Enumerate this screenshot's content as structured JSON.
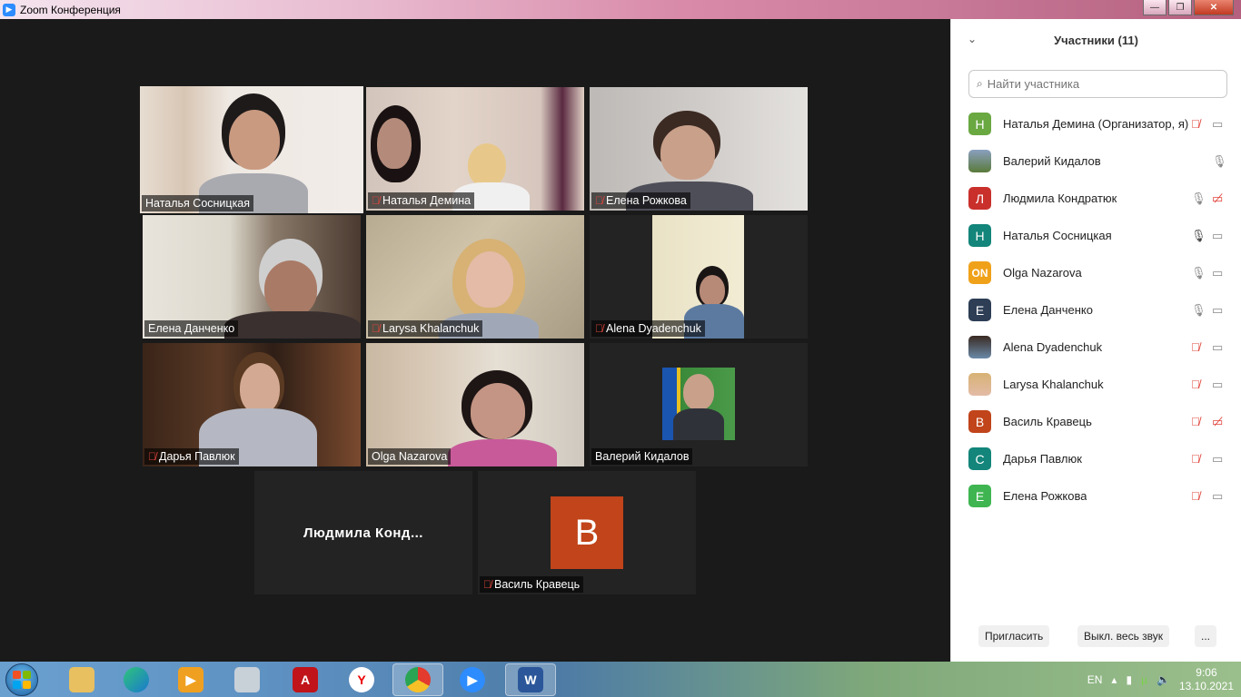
{
  "window": {
    "title": "Zoom Конференция",
    "minimize": "—",
    "maximize": "❐",
    "close": "✕"
  },
  "tiles": [
    {
      "name": "Наталья Сосницкая",
      "muted": false,
      "active": true
    },
    {
      "name": "Наталья Демина",
      "muted": true
    },
    {
      "name": "Елена Рожкова",
      "muted": true
    },
    {
      "name": "Елена Данченко",
      "muted": false
    },
    {
      "name": "Larysa Khalanchuk",
      "muted": true
    },
    {
      "name": "Alena Dyadenchuk",
      "muted": true
    },
    {
      "name": "Дарья Павлюк",
      "muted": true
    },
    {
      "name": "Olga Nazarova",
      "muted": false
    },
    {
      "name": "Валерий Кидалов",
      "muted": false
    },
    {
      "name": "Людмила  Конд...",
      "video": false
    },
    {
      "name": "Василь Кравець",
      "muted": true,
      "avatar_letter": "В"
    }
  ],
  "sidebar": {
    "title": "Участники (11)",
    "search_placeholder": "Найти участника",
    "participants": [
      {
        "name": "Наталья Демина (Организатор, я)",
        "letter": "Н",
        "color": "#6aa842",
        "mic": "muted",
        "cam": "on"
      },
      {
        "name": "Валерий Кидалов",
        "letter": "",
        "color": "#5a7a3a",
        "mic": "on",
        "cam": "none"
      },
      {
        "name": "Людмила Кондратюк",
        "letter": "Л",
        "color": "#c9302c",
        "mic": "on",
        "cam": "off"
      },
      {
        "name": "Наталья Сосницкая",
        "letter": "Н",
        "color": "#13857a",
        "mic": "active",
        "cam": "on"
      },
      {
        "name": "Olga Nazarova",
        "letter": "ON",
        "color": "#f0a11a",
        "mic": "on",
        "cam": "on"
      },
      {
        "name": "Елена Данченко",
        "letter": "Е",
        "color": "#2d3e55",
        "mic": "on",
        "cam": "on"
      },
      {
        "name": "Alena Dyadenchuk",
        "letter": "",
        "color": "#6a5a4a",
        "mic": "muted",
        "cam": "on"
      },
      {
        "name": "Larysa Khalanchuk",
        "letter": "",
        "color": "#c8a070",
        "mic": "muted",
        "cam": "on"
      },
      {
        "name": "Василь Кравець",
        "letter": "В",
        "color": "#c1441a",
        "mic": "muted",
        "cam": "off"
      },
      {
        "name": "Дарья Павлюк",
        "letter": "С",
        "color": "#13857a",
        "mic": "muted",
        "cam": "on"
      },
      {
        "name": "Елена Рожкова",
        "letter": "Е",
        "color": "#3fb551",
        "mic": "muted",
        "cam": "on"
      }
    ],
    "invite": "Пригласить",
    "mute_all": "Выкл. весь звук",
    "more": "..."
  },
  "taskbar": {
    "lang": "EN",
    "time": "9:06",
    "date": "13.10.2021"
  }
}
